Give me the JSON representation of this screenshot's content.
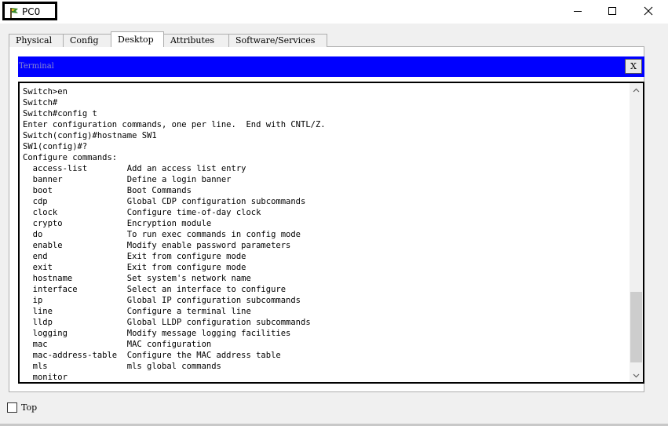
{
  "window": {
    "title": "PC0",
    "controls": [
      "minimize-icon",
      "maximize-icon",
      "close-icon"
    ]
  },
  "tabs": [
    {
      "label": "Physical",
      "active": false
    },
    {
      "label": "Config",
      "active": false
    },
    {
      "label": "Desktop",
      "active": true
    },
    {
      "label": "Attributes",
      "active": false
    },
    {
      "label": "Software/Services",
      "active": false
    }
  ],
  "terminal": {
    "title": "Terminal",
    "close_label": "X",
    "header_color": "#0000ff",
    "lines": [
      "Switch>en",
      "Switch#",
      "Switch#config t",
      "Enter configuration commands, one per line.  End with CNTL/Z.",
      "Switch(config)#hostname SW1",
      "SW1(config)#?",
      "Configure commands:",
      "  access-list        Add an access list entry",
      "  banner             Define a login banner",
      "  boot               Boot Commands",
      "  cdp                Global CDP configuration subcommands",
      "  clock              Configure time-of-day clock",
      "  crypto             Encryption module",
      "  do                 To run exec commands in config mode",
      "  enable             Modify enable password parameters",
      "  end                Exit from configure mode",
      "  exit               Exit from configure mode",
      "  hostname           Set system's network name",
      "  interface          Select an interface to configure",
      "  ip                 Global IP configuration subcommands",
      "  line               Configure a terminal line",
      "  lldp               Global LLDP configuration subcommands",
      "  logging            Modify message logging facilities",
      "  mac                MAC configuration",
      "  mac-address-table  Configure the MAC address table",
      "  mls                mls global commands",
      "  monitor"
    ],
    "scroll_position": 0.97
  },
  "bottom": {
    "top_checkbox_label": "Top",
    "top_checked": false
  }
}
